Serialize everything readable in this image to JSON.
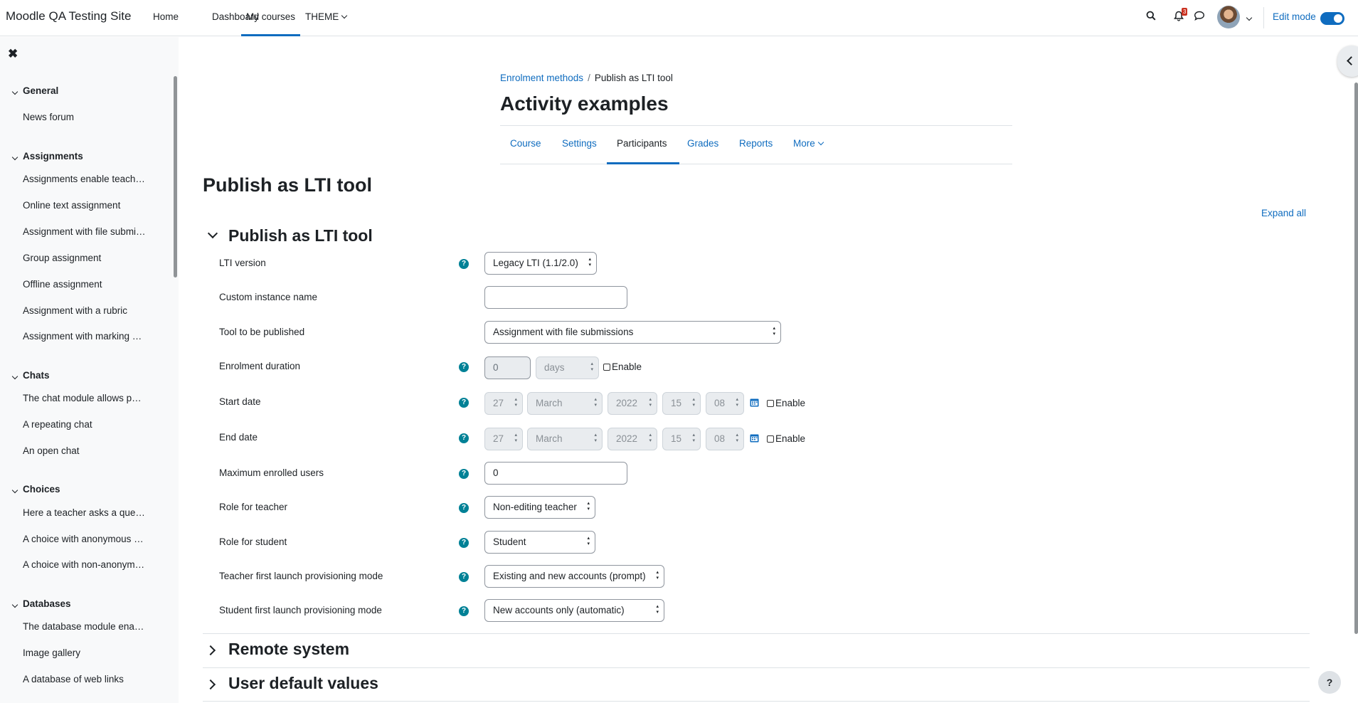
{
  "navbar": {
    "brand": "Moodle QA Testing Site",
    "items": [
      "Home",
      "Dashboard",
      "My courses",
      "THEME"
    ],
    "notification_count": "3",
    "edit_mode_label": "Edit mode"
  },
  "drawer": {
    "sections": [
      {
        "title": "General",
        "items": [
          "News forum"
        ]
      },
      {
        "title": "Assignments",
        "items": [
          "Assignments enable teach…",
          "Online text assignment",
          "Assignment with file submi…",
          "Group assignment",
          "Offline assignment",
          "Assignment with a rubric",
          "Assignment with marking …"
        ]
      },
      {
        "title": "Chats",
        "items": [
          "The chat module allows p…",
          "A repeating chat",
          "An open chat"
        ]
      },
      {
        "title": "Choices",
        "items": [
          "Here a teacher asks a que…",
          "A choice with anonymous …",
          "A choice with non-anonym…"
        ]
      },
      {
        "title": "Databases",
        "items": [
          "The database module ena…",
          "Image gallery",
          "A database of web links"
        ]
      }
    ]
  },
  "breadcrumb": {
    "link": "Enrolment methods",
    "current": "Publish as LTI tool"
  },
  "course_title": "Activity examples",
  "secondary_nav": [
    "Course",
    "Settings",
    "Participants",
    "Grades",
    "Reports",
    "More"
  ],
  "page_title": "Publish as LTI tool",
  "expand_all": "Expand all",
  "fieldsets": {
    "main": "Publish as LTI tool",
    "remote": "Remote system",
    "defaults": "User default values"
  },
  "form": {
    "lti_version": {
      "label": "LTI version",
      "value": "Legacy LTI (1.1/2.0)"
    },
    "custom_name": {
      "label": "Custom instance name",
      "value": ""
    },
    "tool": {
      "label": "Tool to be published",
      "value": "Assignment with file submissions"
    },
    "enrol_duration": {
      "label": "Enrolment duration",
      "value": "0",
      "unit": "days",
      "enable": "Enable"
    },
    "start_date": {
      "label": "Start date",
      "day": "27",
      "month": "March",
      "year": "2022",
      "hour": "15",
      "minute": "08",
      "enable": "Enable"
    },
    "end_date": {
      "label": "End date",
      "day": "27",
      "month": "March",
      "year": "2022",
      "hour": "15",
      "minute": "08",
      "enable": "Enable"
    },
    "max_users": {
      "label": "Maximum enrolled users",
      "value": "0"
    },
    "role_teacher": {
      "label": "Role for teacher",
      "value": "Non-editing teacher"
    },
    "role_student": {
      "label": "Role for student",
      "value": "Student"
    },
    "teacher_mode": {
      "label": "Teacher first launch provisioning mode",
      "value": "Existing and new accounts (prompt)"
    },
    "student_mode": {
      "label": "Student first launch provisioning mode",
      "value": "New accounts only (automatic)"
    }
  },
  "help_fab": "?",
  "colors": {
    "primary": "#0f6cbf",
    "help": "#008196",
    "badge": "#ca3120"
  }
}
